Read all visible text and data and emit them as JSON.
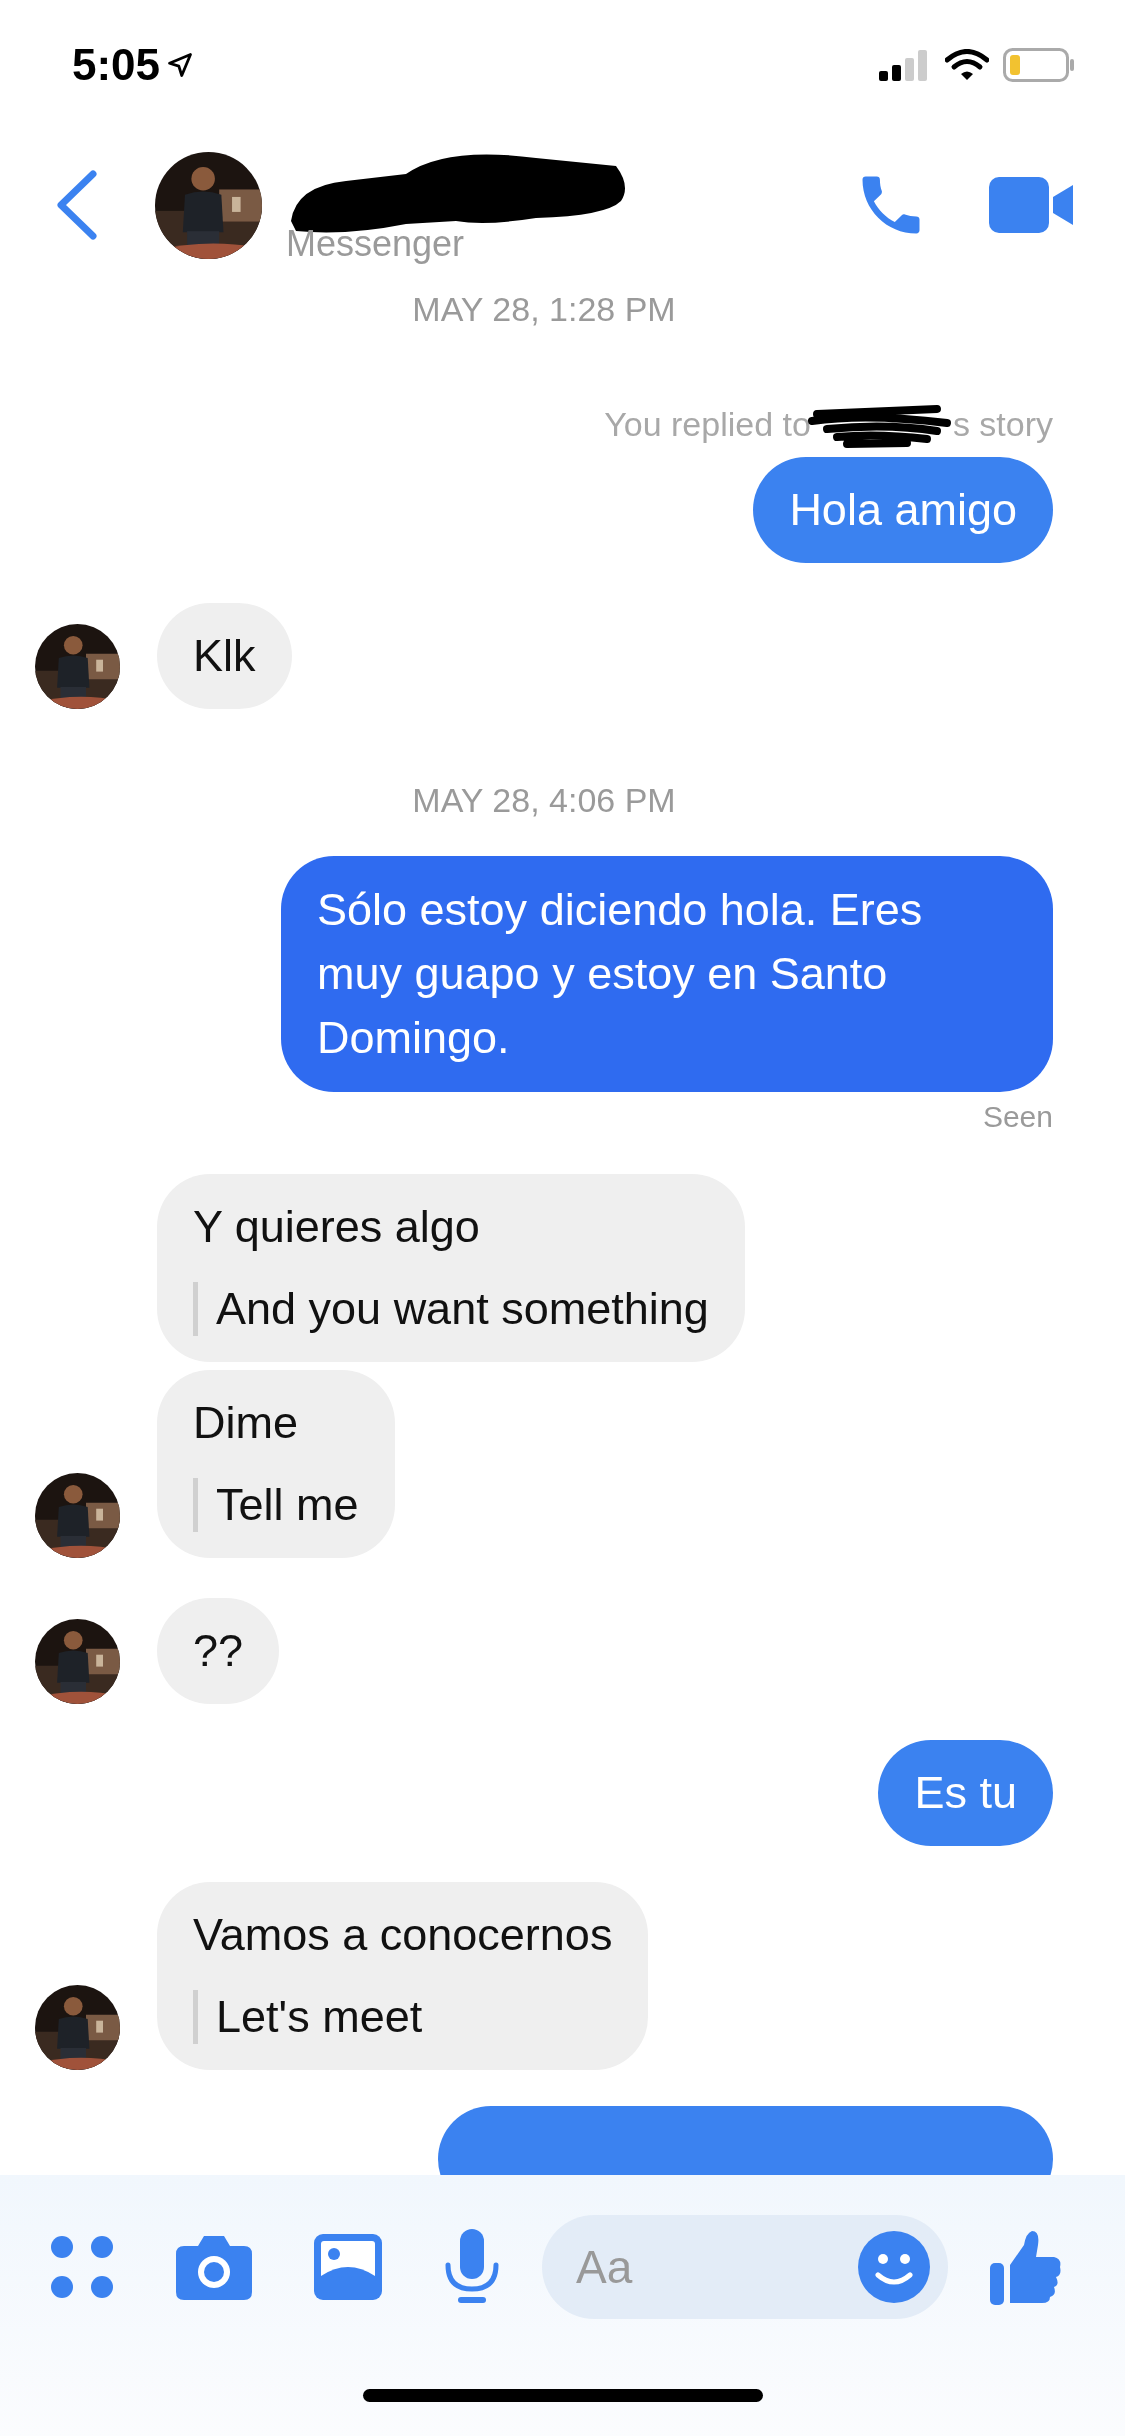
{
  "status_bar": {
    "time": "5:05"
  },
  "header": {
    "subtitle": "Messenger"
  },
  "messages": [
    {
      "kind": "date",
      "text": "MAY 28, 1:28 PM"
    },
    {
      "kind": "story_note",
      "before": "You replied to",
      "after": "s story"
    },
    {
      "kind": "sent",
      "text": "Hola amigo"
    },
    {
      "kind": "received",
      "text": "Klk",
      "show_avatar": true
    },
    {
      "kind": "date",
      "text": "MAY 28, 4:06 PM"
    },
    {
      "kind": "sent",
      "text": "Sólo estoy diciendo hola.  Eres muy guapo y estoy en Santo Domingo."
    },
    {
      "kind": "seen",
      "text": "Seen"
    },
    {
      "kind": "received",
      "text": "Y quieres algo",
      "translation": "And you want something",
      "show_avatar": false
    },
    {
      "kind": "received",
      "text": "Dime",
      "translation": "Tell me",
      "show_avatar": true
    },
    {
      "kind": "received",
      "text": "??",
      "show_avatar": true
    },
    {
      "kind": "sent",
      "text": "Es tu"
    },
    {
      "kind": "received",
      "text": "Vamos a conocernos",
      "translation": "Let's meet",
      "show_avatar": true
    },
    {
      "kind": "sent_cut_off"
    }
  ],
  "composer": {
    "placeholder": "Aa"
  }
}
